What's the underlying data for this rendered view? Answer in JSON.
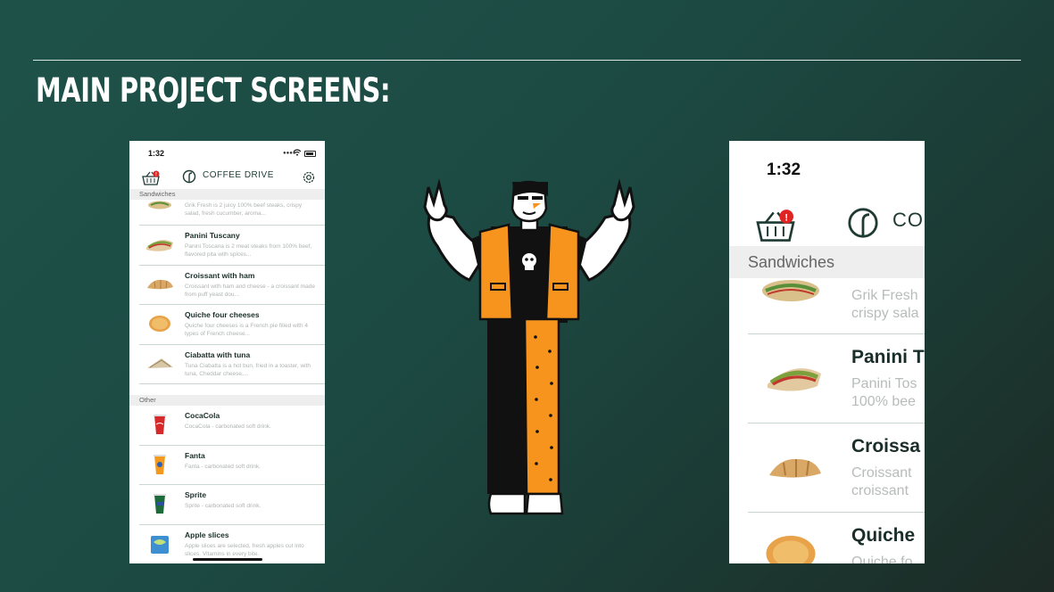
{
  "slide": {
    "title": "MAIN PROJECT SCREENS:"
  },
  "phone_left": {
    "status_time": "1:32",
    "app_name": "COFFEE DRIVE",
    "sections": [
      {
        "title": "Sandwiches",
        "items": [
          {
            "name": "",
            "description": "Grik Fresh is 2 juicy 100% beef steaks, crispy salad, fresh cucumber, aroma..."
          },
          {
            "name": "Panini Tuscany",
            "description": "Panini Toscana is 2 meat steaks from 100% beef, flavored pita with spices..."
          },
          {
            "name": "Croissant with ham",
            "description": "Croissant with ham and cheese - a croissant made from puff yeast dou..."
          },
          {
            "name": "Quiche four cheeses",
            "description": "Quiche four cheeses is a French pie filled with 4 types of French cheese..."
          },
          {
            "name": "Ciabatta with tuna",
            "description": "Tuna Ciabatta is a hot bun, fried in a toaster, with tuna, Cheddar cheese,..."
          }
        ]
      },
      {
        "title": "Other",
        "items": [
          {
            "name": "CocaCola",
            "description": "CocaCola - carbonated soft drink."
          },
          {
            "name": "Fanta",
            "description": "Fanta - carbonated soft drink."
          },
          {
            "name": "Sprite",
            "description": "Sprite - carbonated soft drink."
          },
          {
            "name": "Apple slices",
            "description": "Apple slices are selected, fresh apples cut into slices. Vitamins in every bite."
          }
        ]
      }
    ]
  },
  "phone_right": {
    "status_time": "1:32",
    "app_name_visible": "CO",
    "section_title": "Sandwiches",
    "items": [
      {
        "name": "",
        "desc_line1": "Grik Fresh",
        "desc_line2": "crispy sala"
      },
      {
        "name": "Panini T",
        "desc_line1": "Panini Tos",
        "desc_line2": "100% bee"
      },
      {
        "name": "Croissa",
        "desc_line1": "Croissant",
        "desc_line2": "croissant"
      },
      {
        "name": "Quiche",
        "desc_line1": "Quiche fo",
        "desc_line2": ""
      }
    ]
  },
  "colors": {
    "accent_dark_green": "#1e3a33",
    "badge_red": "#e02424",
    "character_orange": "#f7941d"
  },
  "icons": [
    "cart-icon",
    "coffee-drive-logo-icon",
    "gear-icon",
    "wifi-icon",
    "battery-icon",
    "signal-icon"
  ]
}
